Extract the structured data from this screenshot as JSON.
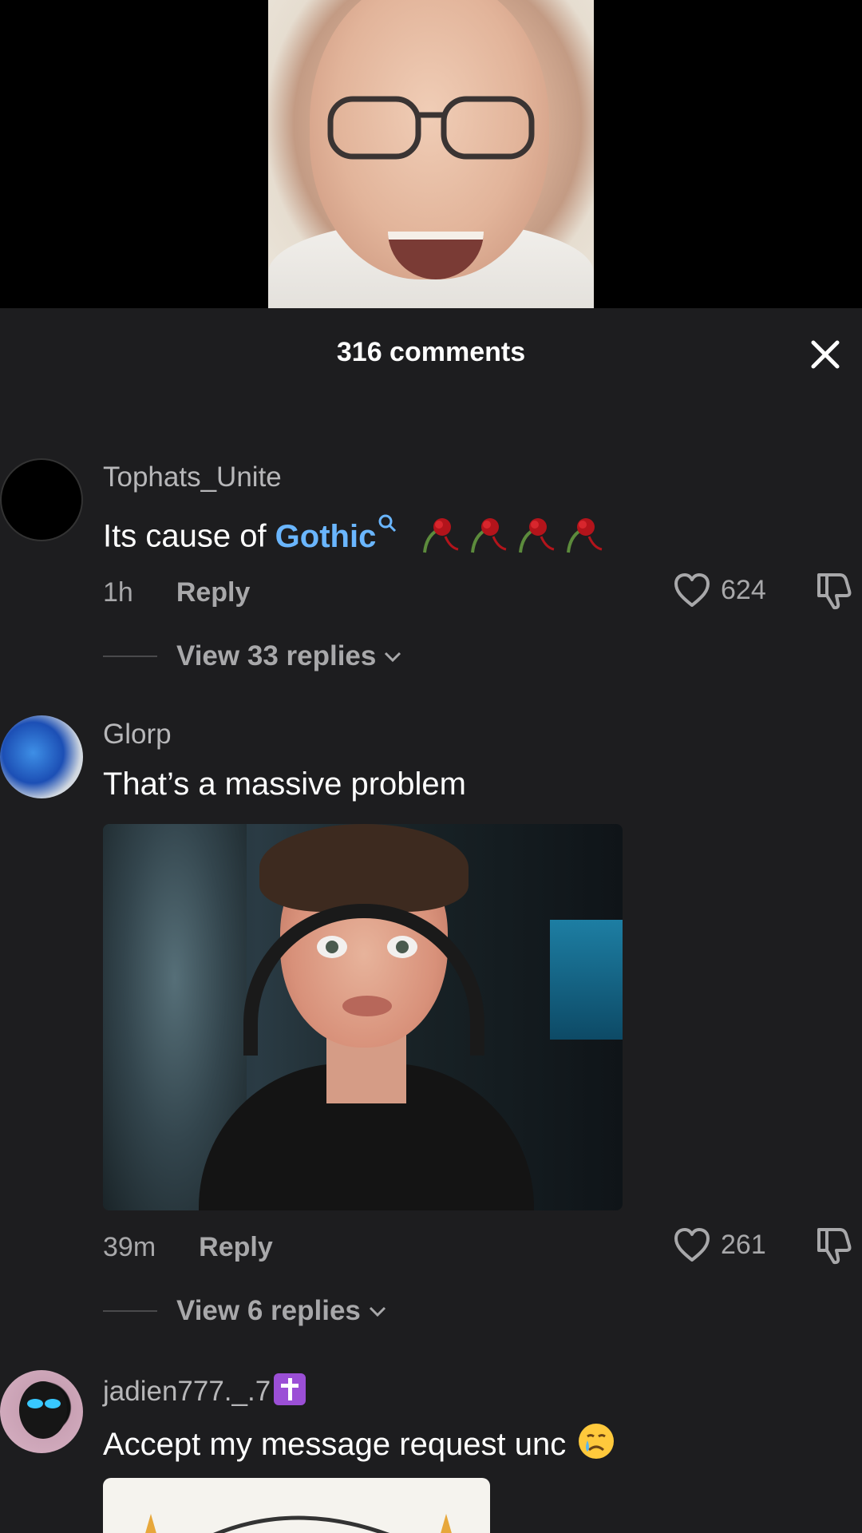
{
  "header": {
    "title": "316 comments",
    "close_icon": "close-icon"
  },
  "comments": [
    {
      "username": "Tophats_Unite",
      "text_prefix": "Its cause of ",
      "text_link": "Gothic",
      "text_emoji": "wilted-rose x4",
      "time": "1h",
      "reply_label": "Reply",
      "likes": "624",
      "view_replies": "View 33 replies"
    },
    {
      "username": "Glorp",
      "text": "That’s a massive problem",
      "time": "39m",
      "reply_label": "Reply",
      "likes": "261",
      "view_replies": "View 6 replies"
    },
    {
      "username": "jadien777._.7",
      "username_badge": "latin-cross-emoji",
      "text": "Accept my message request unc",
      "text_emoji": "crying-face"
    }
  ],
  "colors": {
    "sheet_bg": "#1d1d1f",
    "link": "#6ab6ff",
    "secondary_text": "#a8a8aa"
  }
}
